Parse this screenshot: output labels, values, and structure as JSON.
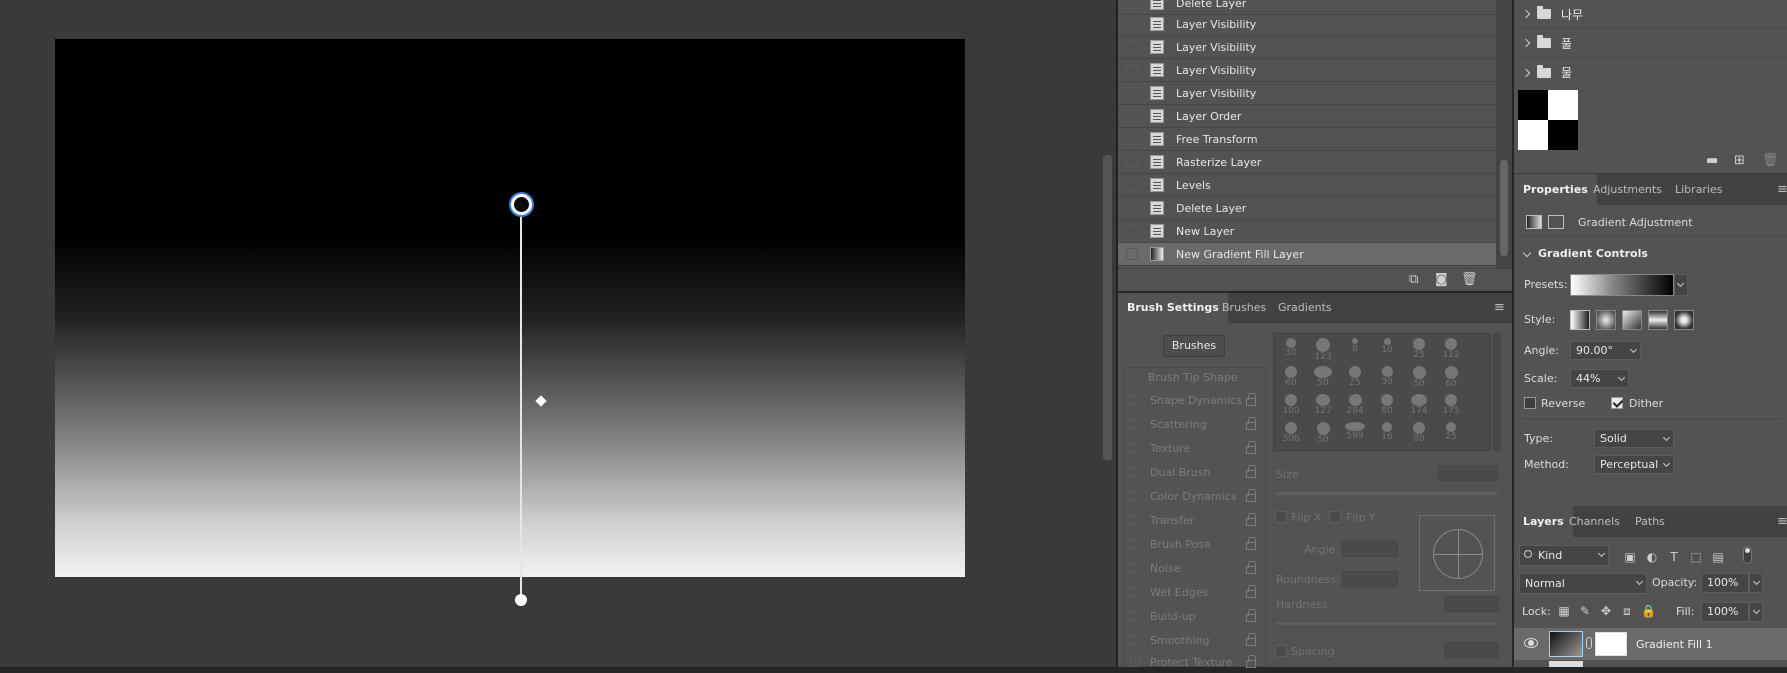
{
  "history": {
    "items": [
      {
        "label": "Delete Layer"
      },
      {
        "label": "Layer Visibility"
      },
      {
        "label": "Layer Visibility"
      },
      {
        "label": "Layer Visibility"
      },
      {
        "label": "Layer Visibility"
      },
      {
        "label": "Layer Order"
      },
      {
        "label": "Free Transform"
      },
      {
        "label": "Rasterize Layer"
      },
      {
        "label": "Levels"
      },
      {
        "label": "Delete Layer"
      },
      {
        "label": "New Layer"
      },
      {
        "label": "New Gradient Fill Layer"
      }
    ],
    "selected_index": 11
  },
  "brush_panel": {
    "tabs": [
      "Brush Settings",
      "Brushes",
      "Gradients"
    ],
    "brushes_button": "Brushes",
    "items": [
      {
        "label": "Brush Tip Shape"
      },
      {
        "label": "Shape Dynamics"
      },
      {
        "label": "Scattering"
      },
      {
        "label": "Texture"
      },
      {
        "label": "Dual Brush"
      },
      {
        "label": "Color Dynamics"
      },
      {
        "label": "Transfer"
      },
      {
        "label": "Brush Pose"
      },
      {
        "label": "Noise"
      },
      {
        "label": "Wet Edges"
      },
      {
        "label": "Build-up"
      },
      {
        "label": "Smoothing"
      },
      {
        "label": "Protect Texture"
      }
    ],
    "tip_sizes": [
      "30",
      "123",
      "8",
      "10",
      "25",
      "112",
      "60",
      "50",
      "25",
      "30",
      "50",
      "60",
      "100",
      "127",
      "284",
      "80",
      "174",
      "175",
      "306",
      "50",
      "599",
      "16",
      "80",
      "25"
    ],
    "size_label": "Size",
    "flip_x": "Flip X",
    "flip_y": "Flip Y",
    "angle_label": "Angle:",
    "roundness_label": "Roundness:",
    "hardness_label": "Hardness",
    "spacing_label": "Spacing"
  },
  "folders": [
    {
      "label": "나무"
    },
    {
      "label": "풀"
    },
    {
      "label": "물"
    }
  ],
  "properties": {
    "tabs": [
      "Properties",
      "Adjustments",
      "Libraries"
    ],
    "header": "Gradient Adjustment",
    "section": "Gradient Controls",
    "presets_label": "Presets:",
    "style_label": "Style:",
    "angle_label": "Angle:",
    "angle_value": "90.00°",
    "scale_label": "Scale:",
    "scale_value": "44%",
    "reverse_label": "Reverse",
    "reverse_checked": false,
    "dither_label": "Dither",
    "dither_checked": true,
    "type_label": "Type:",
    "type_value": "Solid",
    "method_label": "Method:",
    "method_value": "Perceptual"
  },
  "layers": {
    "tabs": [
      "Layers",
      "Channels",
      "Paths"
    ],
    "filter_value": "Kind",
    "blend_mode": "Normal",
    "opacity_label": "Opacity:",
    "opacity_value": "100%",
    "lock_label": "Lock:",
    "fill_label": "Fill:",
    "fill_value": "100%",
    "layer_name": "Gradient Fill 1"
  }
}
